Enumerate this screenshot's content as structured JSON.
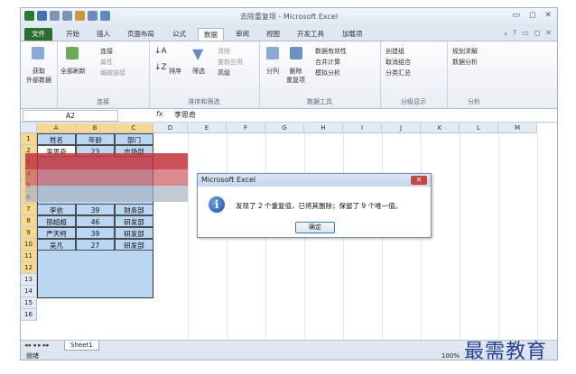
{
  "window": {
    "title": "去除重复项 - Microsoft Excel",
    "controls": [
      "▭",
      "◻",
      "✕"
    ]
  },
  "tabs": [
    "文件",
    "开始",
    "插入",
    "页面布局",
    "公式",
    "数据",
    "审阅",
    "视图",
    "开发工具",
    "加载项"
  ],
  "active_tab": "数据",
  "ribbon": {
    "get_external": "获取\n外部数据",
    "refresh_all": "全部刷新",
    "connections": "连接",
    "properties": "属性",
    "edit_links": "编辑链接",
    "group_connections": "连接",
    "sort": "排序",
    "filter": "筛选",
    "clear": "清除",
    "reapply": "重新应用",
    "advanced": "高级",
    "group_sort_filter": "排序和筛选",
    "text_to_columns": "分列",
    "remove_duplicates": "删除\n重复项",
    "data_validation": "数据有效性",
    "consolidate": "合并计算",
    "what_if": "模拟分析",
    "group_data_tools": "数据工具",
    "group": "创建组",
    "ungroup": "取消组合",
    "subtotal": "分类汇总",
    "group_outline": "分级显示",
    "solver": "规划求解",
    "data_analysis": "数据分析",
    "group_analysis": "分析"
  },
  "formula_bar": {
    "name_box": "A2",
    "fx": "fx",
    "value": "李思奇"
  },
  "columns": [
    "A",
    "B",
    "C",
    "D",
    "E",
    "F",
    "G",
    "H",
    "I",
    "J",
    "K",
    "L",
    "M"
  ],
  "rows": [
    "1",
    "2",
    "3",
    "4",
    "5",
    "6",
    "7",
    "8",
    "9",
    "10",
    "11",
    "12",
    "13",
    "14",
    "15",
    "16"
  ],
  "table": {
    "header": [
      "姓名",
      "年龄",
      "部门"
    ],
    "row2": [
      "李思奇",
      "23",
      "市场部"
    ],
    "row7": [
      "李依",
      "39",
      "财务部"
    ],
    "row8": [
      "邢超超",
      "46",
      "研发部"
    ],
    "row9": [
      "严天柯",
      "39",
      "研发部"
    ],
    "row10": [
      "吴凡",
      "27",
      "研发部"
    ]
  },
  "dialog": {
    "title": "Microsoft Excel",
    "message": "发现了 2 个重复值，已将其删除；保留了 9 个唯一值。",
    "ok": "确定",
    "icon": "info-icon"
  },
  "sheet_tab": "Sheet1",
  "status": {
    "ready": "就绪",
    "zoom": "100%"
  },
  "watermark": "最需教育"
}
